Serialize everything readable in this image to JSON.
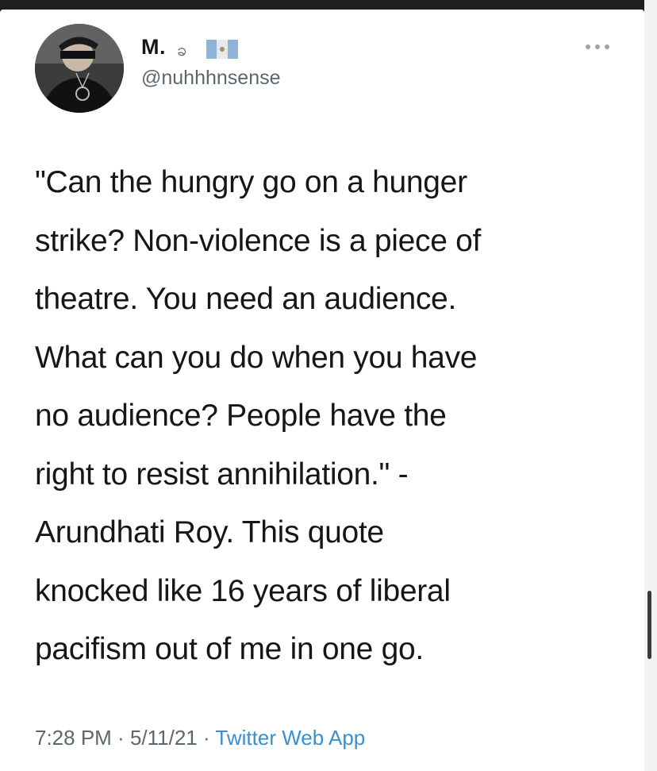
{
  "tweet": {
    "user": {
      "display_name": "M.",
      "name_glyph": "ခ",
      "flag_icon": "flag-icon",
      "handle": "@nuhhhnsense"
    },
    "more_icon": "more-dots-icon",
    "text_lines": [
      "\"Can the hungry go on a hunger",
      "strike? Non-violence is a piece of",
      "theatre. You need an audience.",
      "What can you do when you have",
      "no audience? People have the",
      "right to resist annihilation.\" -",
      "Arundhati Roy. This quote",
      "knocked like 16 years of liberal",
      "pacifism out of me in one go."
    ],
    "time": "7:28 PM",
    "separator": " · ",
    "date": "5/11/21",
    "source": "Twitter Web App"
  },
  "colors": {
    "text": "#14171a",
    "secondary": "#5b6770",
    "link": "#3a8fd0"
  }
}
